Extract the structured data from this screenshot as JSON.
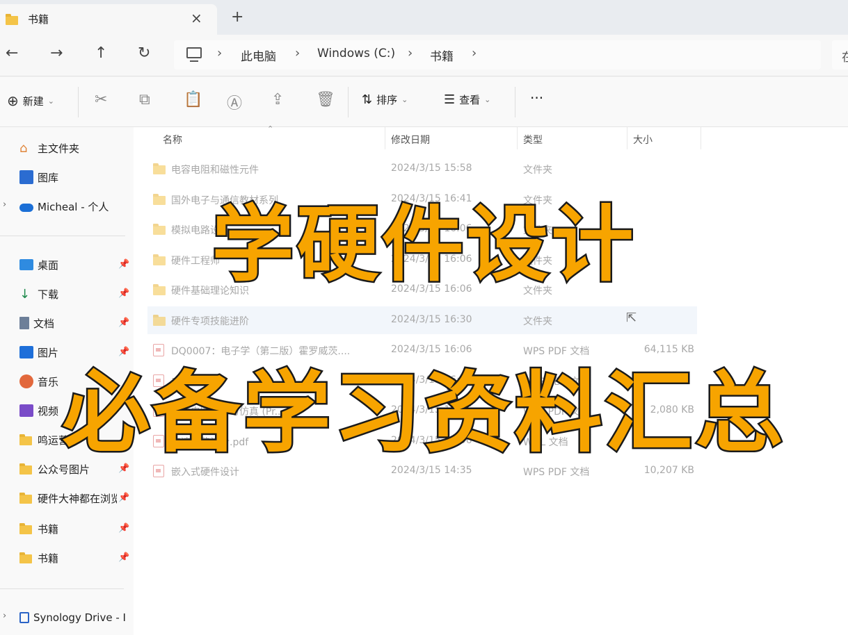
{
  "tab": {
    "title": "书籍",
    "close": "×",
    "new": "+"
  },
  "nav": {
    "back": "←",
    "forward": "→",
    "up": "↑",
    "refresh": "↻",
    "crumbs": [
      "此电脑",
      "Windows (C:)",
      "书籍"
    ],
    "crumb_sep": "›",
    "search_clip": "在"
  },
  "commands": {
    "new_label": "新建",
    "sort_label": "排序",
    "view_label": "查看",
    "more": "···"
  },
  "sidebar": {
    "home": "主文件夹",
    "gallery": "图库",
    "onedrive": "Micheal - 个人",
    "pinned": [
      {
        "label": "桌面",
        "icon": "desktop-icon"
      },
      {
        "label": "下载",
        "icon": "download-icon"
      },
      {
        "label": "文档",
        "icon": "document-icon"
      },
      {
        "label": "图片",
        "icon": "pictures-icon"
      },
      {
        "label": "音乐",
        "icon": "music-icon"
      },
      {
        "label": "视频",
        "icon": "video-icon"
      },
      {
        "label": "鸣运营",
        "icon": "folder-icon"
      },
      {
        "label": "公众号图片",
        "icon": "folder-icon"
      },
      {
        "label": "硬件大神都在浏览",
        "icon": "folder-icon"
      },
      {
        "label": "书籍",
        "icon": "folder-icon"
      },
      {
        "label": "书籍",
        "icon": "folder-icon"
      }
    ],
    "synology": "Synology Drive - I"
  },
  "columns": {
    "name": "名称",
    "modified": "修改日期",
    "type": "类型",
    "size": "大小"
  },
  "files": [
    {
      "name": "电容电阻和磁性元件",
      "date": "2024/3/15 15:58",
      "type": "文件夹",
      "size": "",
      "kind": "folder"
    },
    {
      "name": "国外电子与通信教材系列",
      "date": "2024/3/15 16:41",
      "type": "文件夹",
      "size": "",
      "kind": "folder"
    },
    {
      "name": "模拟电路设计",
      "date": "2024/3/15 16:06",
      "type": "文件夹",
      "size": "",
      "kind": "folder"
    },
    {
      "name": "硬件工程师",
      "date": "2024/3/15 16:06",
      "type": "文件夹",
      "size": "",
      "kind": "folder"
    },
    {
      "name": "硬件基础理论知识",
      "date": "2024/3/15 16:06",
      "type": "文件夹",
      "size": "",
      "kind": "folder"
    },
    {
      "name": "硬件专项技能进阶",
      "date": "2024/3/15 16:30",
      "type": "文件夹",
      "size": "",
      "kind": "folder"
    },
    {
      "name": "DQ0007：电子学（第二版）霍罗威茨....",
      "date": "2024/3/15 16:06",
      "type": "WPS PDF 文档",
      "size": "64,115 KB",
      "kind": "pdf"
    },
    {
      "name": "电路设计",
      "date": "2024/3/15 16:06",
      "type": "WPS PDF 文档",
      "size": "",
      "kind": "pdf"
    },
    {
      "name": "硬件电路设计与仿真 (Pr...",
      "date": "2024/3/15 16:06",
      "type": "WPS PDF 文档",
      "size": "2,080 KB",
      "kind": "pdf"
    },
    {
      "name": "高速电路设计.pdf",
      "date": "2024/3/15 16:06",
      "type": "WNL 文档",
      "size": "",
      "kind": "pdf"
    },
    {
      "name": "嵌入式硬件设计",
      "date": "2024/3/15 14:35",
      "type": "WPS PDF 文档",
      "size": "10,207 KB",
      "kind": "pdf"
    }
  ],
  "overlay": {
    "line1": "学硬件设计",
    "line2": "必备学习资料汇总"
  },
  "colors": {
    "overlay_fill": "#f7a400",
    "overlay_stroke": "#1a1a1a",
    "folder": "#f4c448"
  }
}
